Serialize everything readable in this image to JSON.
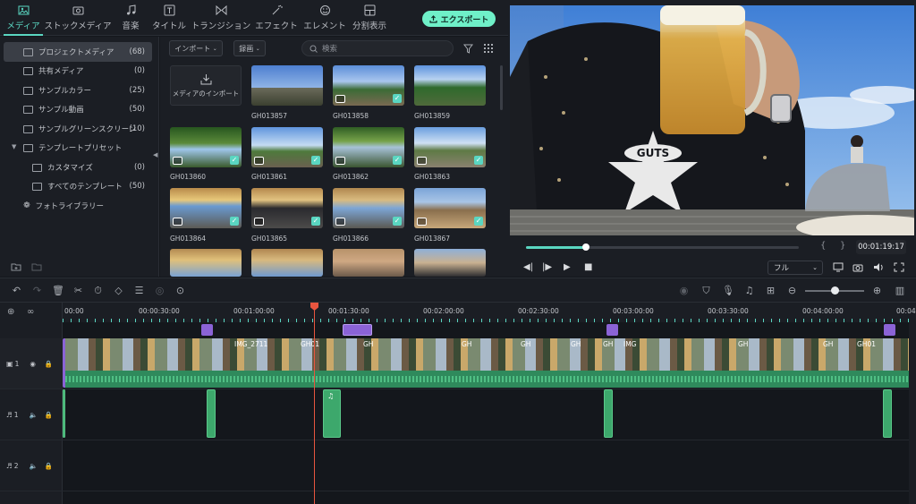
{
  "top_tabs": [
    {
      "label": "メディア",
      "icon": "media-icon",
      "active": true
    },
    {
      "label": "ストックメディア",
      "icon": "stock-media-icon"
    },
    {
      "label": "音楽",
      "icon": "music-icon"
    },
    {
      "label": "タイトル",
      "icon": "title-icon"
    },
    {
      "label": "トランジション",
      "icon": "transition-icon"
    },
    {
      "label": "エフェクト",
      "icon": "effect-icon"
    },
    {
      "label": "エレメント",
      "icon": "element-icon"
    },
    {
      "label": "分割表示",
      "icon": "split-screen-icon"
    }
  ],
  "export_label": "エクスポート",
  "sidebar": {
    "items": [
      {
        "label": "プロジェクトメディア",
        "count": "(68)"
      },
      {
        "label": "共有メディア",
        "count": "(0)"
      },
      {
        "label": "サンプルカラー",
        "count": "(25)"
      },
      {
        "label": "サンプル動画",
        "count": "(50)"
      },
      {
        "label": "サンプルグリーンスクリーン",
        "count": "(10)"
      },
      {
        "label": "テンプレートプリセット",
        "count": ""
      },
      {
        "label": "カスタマイズ",
        "count": "(0)"
      },
      {
        "label": "すべてのテンプレート",
        "count": "(50)"
      },
      {
        "label": "フォトライブラリー",
        "count": ""
      }
    ]
  },
  "media": {
    "import_dropdown": "インポート",
    "record_dropdown": "録画",
    "search_placeholder": "検索",
    "import_tile_label": "メディアのインポート",
    "clips": [
      {
        "name": "GH013857"
      },
      {
        "name": "GH013858"
      },
      {
        "name": "GH013859"
      },
      {
        "name": "GH013860"
      },
      {
        "name": "GH013861"
      },
      {
        "name": "GH013862"
      },
      {
        "name": "GH013863"
      },
      {
        "name": "GH013864"
      },
      {
        "name": "GH013865"
      },
      {
        "name": "GH013866"
      },
      {
        "name": "GH013867"
      }
    ]
  },
  "preview": {
    "timecode": "00:01:19:17",
    "quality": "フル",
    "shirt_text": "GUTS",
    "progress": 0.22
  },
  "ruler": {
    "labels": [
      "00:00",
      "00:00:30:00",
      "00:01:00:00",
      "00:01:30:00",
      "00:02:00:00",
      "00:02:30:00",
      "00:03:00:00",
      "00:03:30:00",
      "00:04:00:00",
      "00:04:"
    ]
  },
  "tracks": [
    {
      "label": "1",
      "type": "video"
    },
    {
      "label": "1",
      "type": "audio"
    },
    {
      "label": "2",
      "type": "audio"
    }
  ],
  "clip_labels": [
    "IMG_2711",
    "GH01",
    "GH",
    "GH",
    "GH",
    "GH",
    "GH",
    "IMG",
    "GH",
    "GH",
    "GH01"
  ]
}
